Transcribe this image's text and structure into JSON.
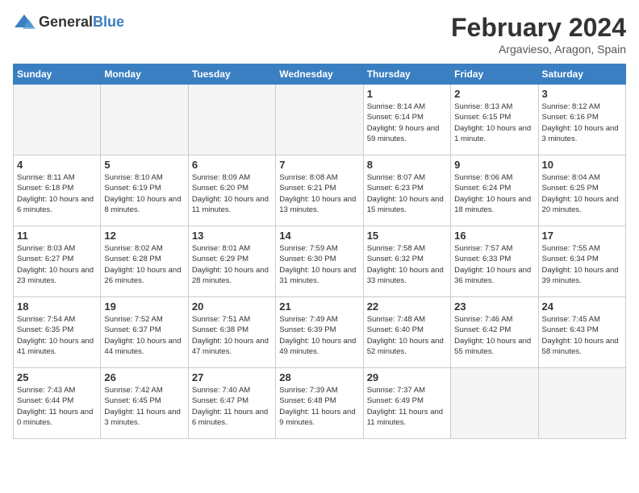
{
  "logo": {
    "general": "General",
    "blue": "Blue"
  },
  "header": {
    "month_year": "February 2024",
    "location": "Argavieso, Aragon, Spain"
  },
  "weekdays": [
    "Sunday",
    "Monday",
    "Tuesday",
    "Wednesday",
    "Thursday",
    "Friday",
    "Saturday"
  ],
  "weeks": [
    [
      {
        "day": "",
        "empty": true
      },
      {
        "day": "",
        "empty": true
      },
      {
        "day": "",
        "empty": true
      },
      {
        "day": "",
        "empty": true
      },
      {
        "day": "1",
        "sunrise": "8:14 AM",
        "sunset": "6:14 PM",
        "daylight": "9 hours and 59 minutes."
      },
      {
        "day": "2",
        "sunrise": "8:13 AM",
        "sunset": "6:15 PM",
        "daylight": "10 hours and 1 minute."
      },
      {
        "day": "3",
        "sunrise": "8:12 AM",
        "sunset": "6:16 PM",
        "daylight": "10 hours and 3 minutes."
      }
    ],
    [
      {
        "day": "4",
        "sunrise": "8:11 AM",
        "sunset": "6:18 PM",
        "daylight": "10 hours and 6 minutes."
      },
      {
        "day": "5",
        "sunrise": "8:10 AM",
        "sunset": "6:19 PM",
        "daylight": "10 hours and 8 minutes."
      },
      {
        "day": "6",
        "sunrise": "8:09 AM",
        "sunset": "6:20 PM",
        "daylight": "10 hours and 11 minutes."
      },
      {
        "day": "7",
        "sunrise": "8:08 AM",
        "sunset": "6:21 PM",
        "daylight": "10 hours and 13 minutes."
      },
      {
        "day": "8",
        "sunrise": "8:07 AM",
        "sunset": "6:23 PM",
        "daylight": "10 hours and 15 minutes."
      },
      {
        "day": "9",
        "sunrise": "8:06 AM",
        "sunset": "6:24 PM",
        "daylight": "10 hours and 18 minutes."
      },
      {
        "day": "10",
        "sunrise": "8:04 AM",
        "sunset": "6:25 PM",
        "daylight": "10 hours and 20 minutes."
      }
    ],
    [
      {
        "day": "11",
        "sunrise": "8:03 AM",
        "sunset": "6:27 PM",
        "daylight": "10 hours and 23 minutes."
      },
      {
        "day": "12",
        "sunrise": "8:02 AM",
        "sunset": "6:28 PM",
        "daylight": "10 hours and 26 minutes."
      },
      {
        "day": "13",
        "sunrise": "8:01 AM",
        "sunset": "6:29 PM",
        "daylight": "10 hours and 28 minutes."
      },
      {
        "day": "14",
        "sunrise": "7:59 AM",
        "sunset": "6:30 PM",
        "daylight": "10 hours and 31 minutes."
      },
      {
        "day": "15",
        "sunrise": "7:58 AM",
        "sunset": "6:32 PM",
        "daylight": "10 hours and 33 minutes."
      },
      {
        "day": "16",
        "sunrise": "7:57 AM",
        "sunset": "6:33 PM",
        "daylight": "10 hours and 36 minutes."
      },
      {
        "day": "17",
        "sunrise": "7:55 AM",
        "sunset": "6:34 PM",
        "daylight": "10 hours and 39 minutes."
      }
    ],
    [
      {
        "day": "18",
        "sunrise": "7:54 AM",
        "sunset": "6:35 PM",
        "daylight": "10 hours and 41 minutes."
      },
      {
        "day": "19",
        "sunrise": "7:52 AM",
        "sunset": "6:37 PM",
        "daylight": "10 hours and 44 minutes."
      },
      {
        "day": "20",
        "sunrise": "7:51 AM",
        "sunset": "6:38 PM",
        "daylight": "10 hours and 47 minutes."
      },
      {
        "day": "21",
        "sunrise": "7:49 AM",
        "sunset": "6:39 PM",
        "daylight": "10 hours and 49 minutes."
      },
      {
        "day": "22",
        "sunrise": "7:48 AM",
        "sunset": "6:40 PM",
        "daylight": "10 hours and 52 minutes."
      },
      {
        "day": "23",
        "sunrise": "7:46 AM",
        "sunset": "6:42 PM",
        "daylight": "10 hours and 55 minutes."
      },
      {
        "day": "24",
        "sunrise": "7:45 AM",
        "sunset": "6:43 PM",
        "daylight": "10 hours and 58 minutes."
      }
    ],
    [
      {
        "day": "25",
        "sunrise": "7:43 AM",
        "sunset": "6:44 PM",
        "daylight": "11 hours and 0 minutes."
      },
      {
        "day": "26",
        "sunrise": "7:42 AM",
        "sunset": "6:45 PM",
        "daylight": "11 hours and 3 minutes."
      },
      {
        "day": "27",
        "sunrise": "7:40 AM",
        "sunset": "6:47 PM",
        "daylight": "11 hours and 6 minutes."
      },
      {
        "day": "28",
        "sunrise": "7:39 AM",
        "sunset": "6:48 PM",
        "daylight": "11 hours and 9 minutes."
      },
      {
        "day": "29",
        "sunrise": "7:37 AM",
        "sunset": "6:49 PM",
        "daylight": "11 hours and 11 minutes."
      },
      {
        "day": "",
        "empty": true
      },
      {
        "day": "",
        "empty": true
      }
    ]
  ]
}
